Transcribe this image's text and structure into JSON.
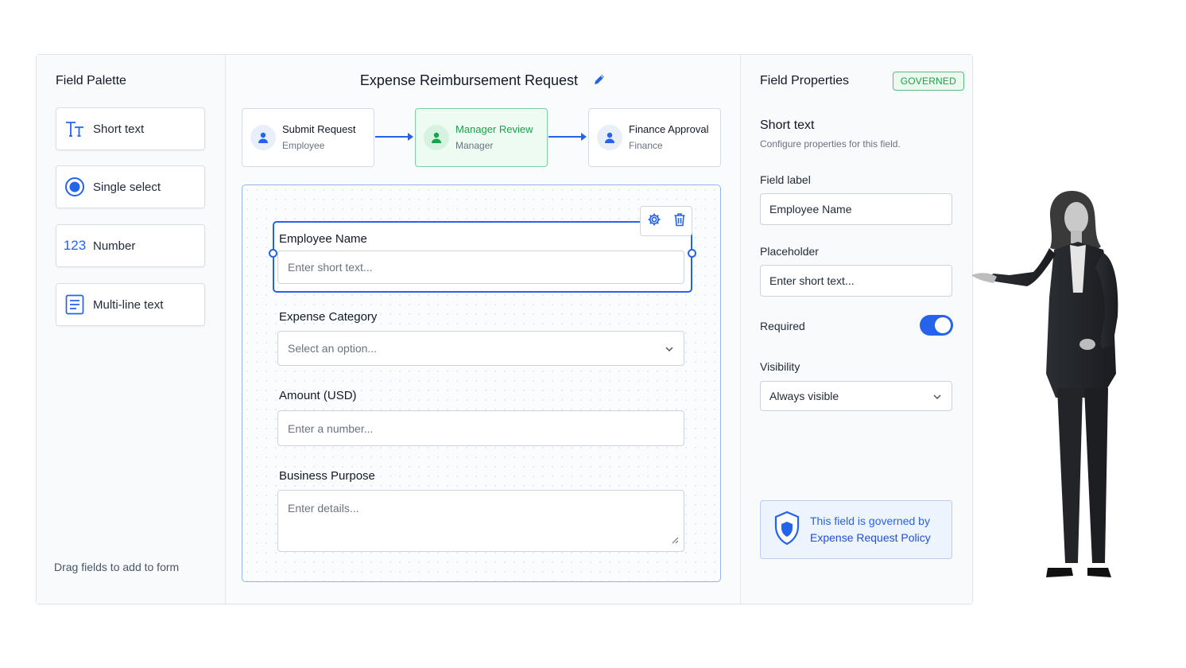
{
  "palette": {
    "title": "Field Palette",
    "items": [
      {
        "label": "Short text",
        "icon": "text-type-icon"
      },
      {
        "label": "Single select",
        "icon": "radio-icon"
      },
      {
        "label": "Number",
        "icon_text": "123",
        "icon": "number-icon"
      },
      {
        "label": "Multi-line text",
        "icon": "multiline-icon"
      }
    ],
    "hint": "Drag fields to add to form"
  },
  "form": {
    "title": "Expense Reimbursement Request",
    "steps": [
      {
        "title": "Submit Request",
        "role": "Employee"
      },
      {
        "title": "Manager Review",
        "role": "Manager"
      },
      {
        "title": "Finance Approval",
        "role": "Finance"
      }
    ],
    "fields": [
      {
        "label": "Employee Name",
        "placeholder": "Enter short text..."
      },
      {
        "label": "Expense Category",
        "placeholder": "Select an option..."
      },
      {
        "label": "Amount (USD)",
        "placeholder": "Enter a number..."
      },
      {
        "label": "Business Purpose",
        "placeholder": "Enter details..."
      }
    ]
  },
  "props": {
    "title": "Field Properties",
    "badge": "GOVERNED",
    "field_type": "Short text",
    "field_type_sub": "Configure properties for this field.",
    "label_label": "Field label",
    "label_value": "Employee Name",
    "placeholder_label": "Placeholder",
    "placeholder_value": "Enter short text...",
    "required_label": "Required",
    "required": true,
    "visibility_label": "Visibility",
    "visibility_value": "Always visible",
    "policy_line1": "This field is governed by",
    "policy_line2": "Expense Request Policy"
  },
  "colors": {
    "accent": "#2563eb",
    "success": "#16a34a"
  }
}
